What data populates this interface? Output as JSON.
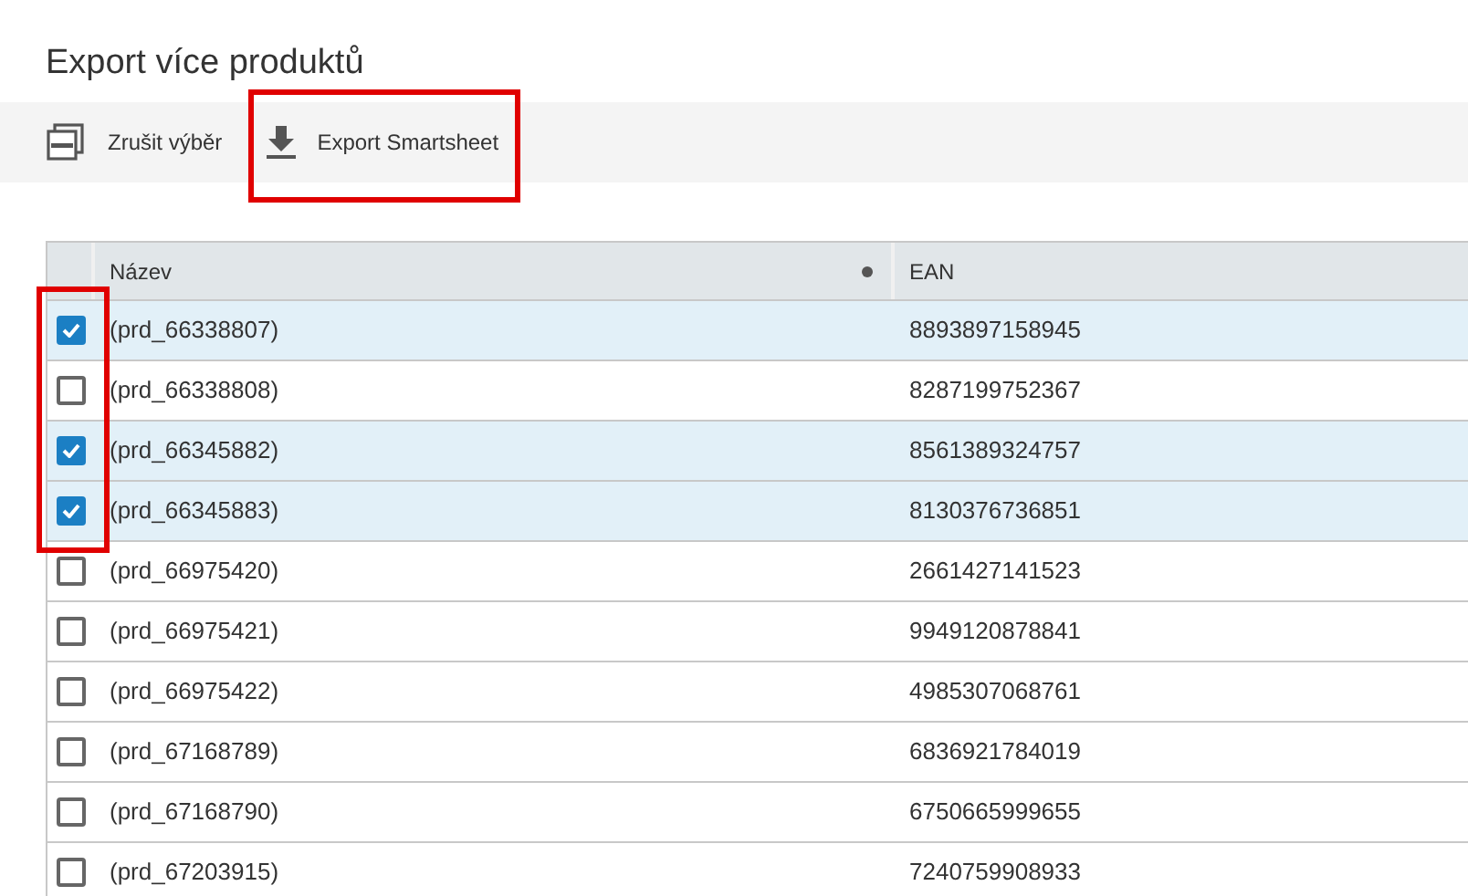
{
  "title": "Export více produktů",
  "toolbar": [
    {
      "kind": "deselect",
      "label": "Zrušit výběr",
      "highlighted": false
    },
    {
      "kind": "download",
      "label": "Export Smartsheet",
      "highlighted": true
    }
  ],
  "table": {
    "columns": [
      {
        "label": "Název",
        "menu_dot": true
      },
      {
        "label": "EAN",
        "menu_dot": false
      }
    ],
    "rows": [
      {
        "name": "(prd_66338807)",
        "ean": "8893897158945",
        "selected": true,
        "highlighted": true
      },
      {
        "name": "(prd_66338808)",
        "ean": "8287199752367",
        "selected": false,
        "highlighted": true
      },
      {
        "name": "(prd_66345882)",
        "ean": "8561389324757",
        "selected": true,
        "highlighted": true
      },
      {
        "name": "(prd_66345883)",
        "ean": "8130376736851",
        "selected": true,
        "highlighted": true
      },
      {
        "name": "(prd_66975420)",
        "ean": "2661427141523",
        "selected": false,
        "highlighted": false
      },
      {
        "name": "(prd_66975421)",
        "ean": "9949120878841",
        "selected": false,
        "highlighted": false
      },
      {
        "name": "(prd_66975422)",
        "ean": "4985307068761",
        "selected": false,
        "highlighted": false
      },
      {
        "name": "(prd_67168789)",
        "ean": "6836921784019",
        "selected": false,
        "highlighted": false
      },
      {
        "name": "(prd_67168790)",
        "ean": "6750665999655",
        "selected": false,
        "highlighted": false
      },
      {
        "name": "(prd_67203915)",
        "ean": "7240759908933",
        "selected": false,
        "highlighted": false
      }
    ]
  }
}
